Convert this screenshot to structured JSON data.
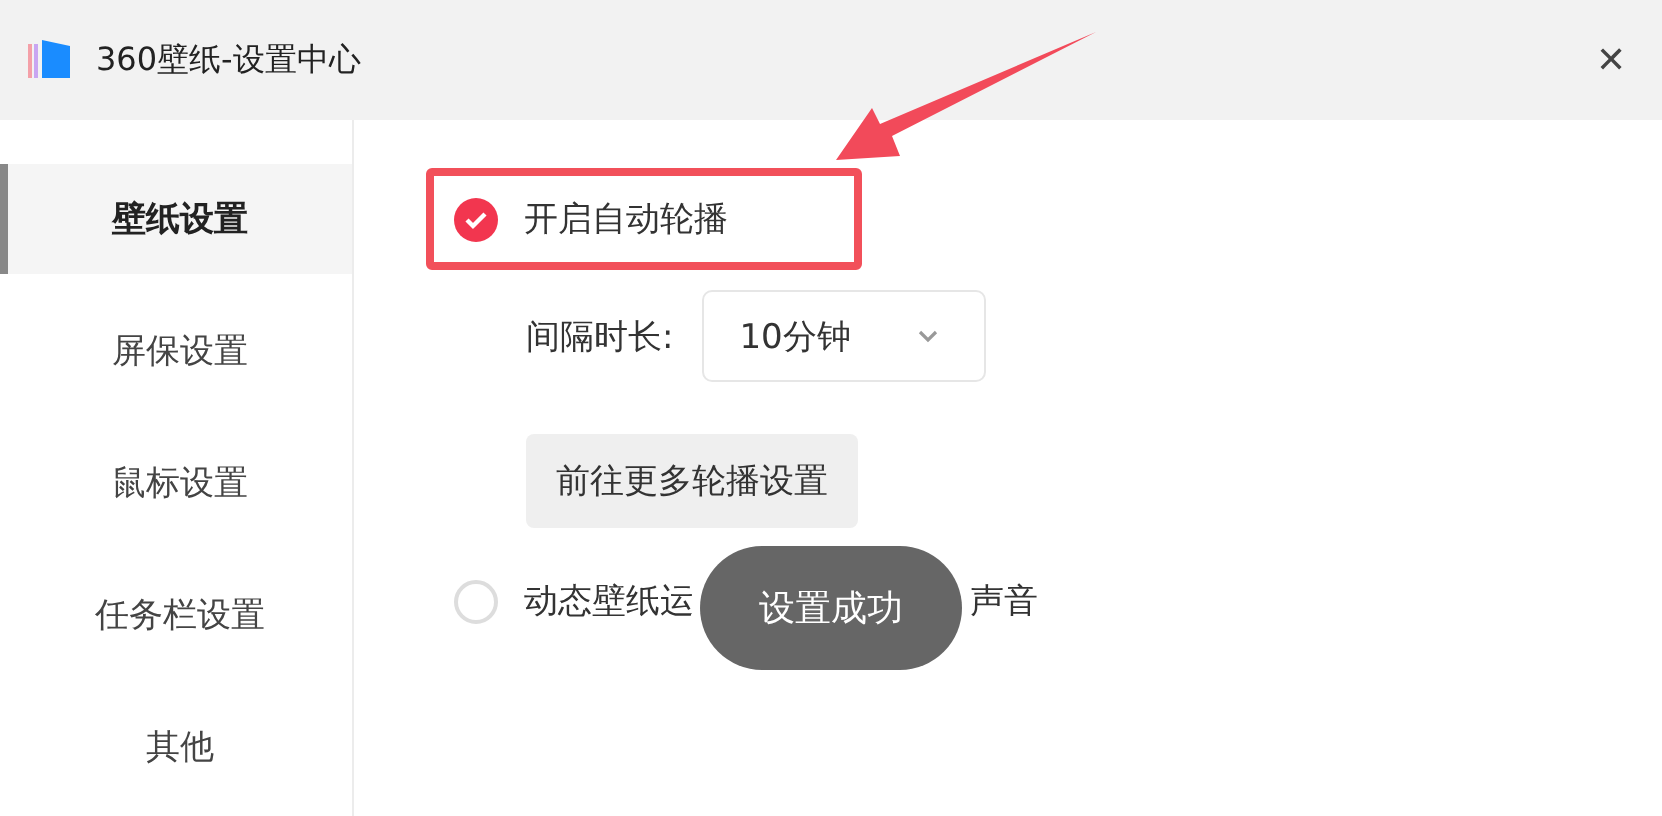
{
  "window": {
    "title": "360壁纸-设置中心",
    "close": "✕"
  },
  "sidebar": {
    "items": [
      {
        "label": "壁纸设置",
        "selected": true
      },
      {
        "label": "屏保设置",
        "selected": false
      },
      {
        "label": "鼠标设置",
        "selected": false
      },
      {
        "label": "任务栏设置",
        "selected": false
      },
      {
        "label": "其他",
        "selected": false
      }
    ]
  },
  "auto_rotate": {
    "label": "开启自动轮播",
    "checked": true
  },
  "interval": {
    "label": "间隔时长:",
    "value": "10分钟"
  },
  "more_button": "前往更多轮播设置",
  "sound": {
    "label_start": "动态壁纸运",
    "label_end": "声音",
    "checked": false
  },
  "toast": "设置成功"
}
